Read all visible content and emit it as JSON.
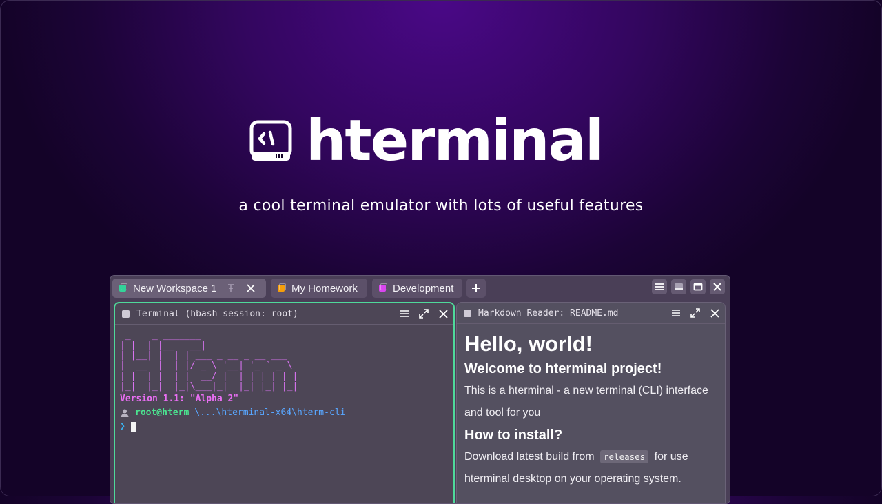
{
  "brand": {
    "name": "hterminal"
  },
  "tagline": "a cool terminal emulator with lots of useful features",
  "tabs": [
    {
      "label": "New Workspace 1",
      "color": "#34d399",
      "active": true
    },
    {
      "label": "My Homework",
      "color": "#f59e0b",
      "active": false
    },
    {
      "label": "Development",
      "color": "#d946ef",
      "active": false
    }
  ],
  "panes": {
    "terminal": {
      "title": "Terminal (hbash session: root)",
      "ascii_art": " _    _ _______\n| |  | |__   __|\n| |__| |  | | ___ _ __ _ __ ___\n|  __  |  | |/ _ \\ '__| '_ ` _ \\\n| |  | |  | |  __/ |  | | | | | |\n|_|  |_|  |_|\\___|_|  |_| |_| |_|",
      "version_line": "Version 1.1: \"Alpha 2\"",
      "user": "root@hterm",
      "path": "\\...\\hterminal-x64\\hterm-cli",
      "prompt_symbol": "❯"
    },
    "markdown": {
      "title": "Markdown Reader: README.md",
      "h1": "Hello, world!",
      "h2_welcome": "Welcome to hterminal project!",
      "p_intro": "This is a hterminal - a new terminal (CLI) interface and tool for you",
      "h2_install": "How to install?",
      "p_install_before": "Download latest build from",
      "p_install_code": "releases",
      "p_install_after": "for use hterminal desktop on your operating system."
    }
  },
  "colors": {
    "accent_green": "#4fd99a",
    "ascii_magenta": "#d873f0",
    "path_blue": "#58a6ff",
    "bg_purple": "#4a0887"
  }
}
